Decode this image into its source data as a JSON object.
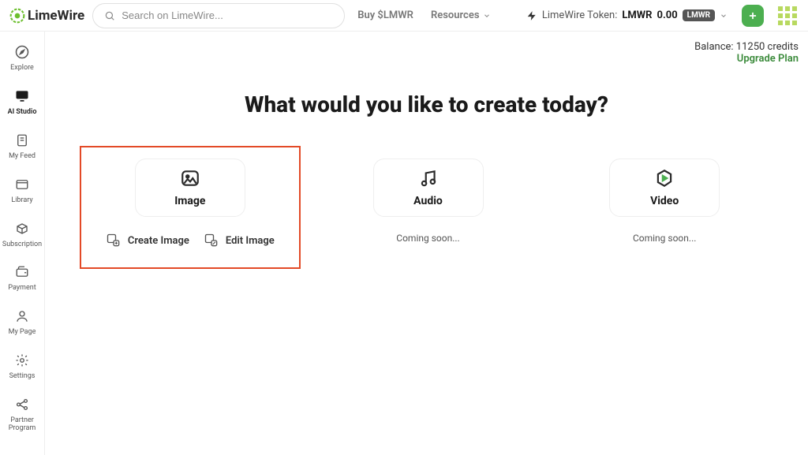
{
  "header": {
    "logo_text": "LimeWire",
    "search_placeholder": "Search on LimeWire...",
    "buy_link": "Buy $LMWR",
    "resources": "Resources",
    "token_label": "LimeWire Token:",
    "token_symbol": "LMWR",
    "token_value": "0.00",
    "token_badge": "LMWR"
  },
  "sidebar": {
    "items": [
      {
        "label": "Explore",
        "icon": "compass"
      },
      {
        "label": "AI Studio",
        "icon": "display",
        "active": true
      },
      {
        "label": "My Feed",
        "icon": "document"
      },
      {
        "label": "Library",
        "icon": "library"
      },
      {
        "label": "Subscription",
        "icon": "box"
      },
      {
        "label": "Payment",
        "icon": "wallet"
      },
      {
        "label": "My Page",
        "icon": "person"
      },
      {
        "label": "Settings",
        "icon": "gear"
      },
      {
        "label": "Partner Program",
        "icon": "share"
      }
    ]
  },
  "main": {
    "balance_text": "Balance: 11250 credits",
    "upgrade_text": "Upgrade Plan",
    "page_title": "What would you like to create today?",
    "cards": [
      {
        "label": "Image",
        "highlighted": true,
        "actions": [
          {
            "label": "Create Image"
          },
          {
            "label": "Edit Image"
          }
        ]
      },
      {
        "label": "Audio",
        "coming_soon": "Coming soon..."
      },
      {
        "label": "Video",
        "coming_soon": "Coming soon..."
      }
    ]
  }
}
